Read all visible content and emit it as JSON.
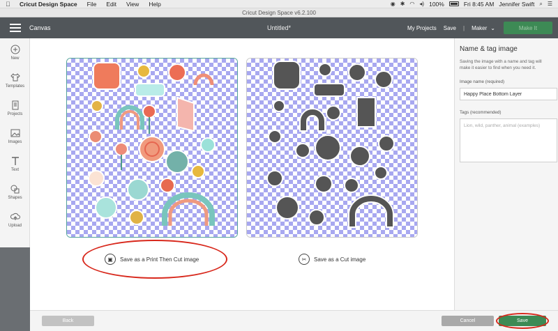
{
  "menubar": {
    "app_name": "Cricut Design Space",
    "menus": [
      "File",
      "Edit",
      "View",
      "Help"
    ],
    "battery": "100%",
    "clock": "Fri 8:45 AM",
    "user": "Jennifer Swift"
  },
  "window": {
    "title": "Cricut Design Space  v6.2.100"
  },
  "header": {
    "section": "Canvas",
    "project_title": "Untitled*",
    "my_projects": "My Projects",
    "save": "Save",
    "separator": "|",
    "machine": "Maker",
    "make_button": "Make It"
  },
  "sidebar": {
    "items": [
      {
        "label": "New",
        "icon": "plus-icon"
      },
      {
        "label": "Templates",
        "icon": "shirt-icon"
      },
      {
        "label": "Projects",
        "icon": "projects-icon"
      },
      {
        "label": "Images",
        "icon": "image-icon"
      },
      {
        "label": "Text",
        "icon": "text-icon"
      },
      {
        "label": "Shapes",
        "icon": "shapes-icon"
      },
      {
        "label": "Upload",
        "icon": "upload-icon"
      }
    ]
  },
  "options": {
    "print_then_cut": "Save as a Print Then Cut image",
    "cut": "Save as a Cut image"
  },
  "tag_panel": {
    "title": "Name & tag image",
    "description": "Saving the image with a name and tag will make it easier to find when you need it.",
    "name_label": "Image name (required)",
    "name_value": "Happy Place Bottom Layer",
    "tags_label": "Tags (recommended)",
    "tags_placeholder": "Lion, wild, panther, animal (examples)"
  },
  "footer": {
    "back": "Back",
    "cancel": "Cancel",
    "save": "Save"
  },
  "colors": {
    "header_bg": "#51565a",
    "accent_green": "#3d8a55",
    "checker_blue": "#a8a8f0",
    "annotation_red": "#d8281c",
    "cut_shape": "#555555"
  }
}
